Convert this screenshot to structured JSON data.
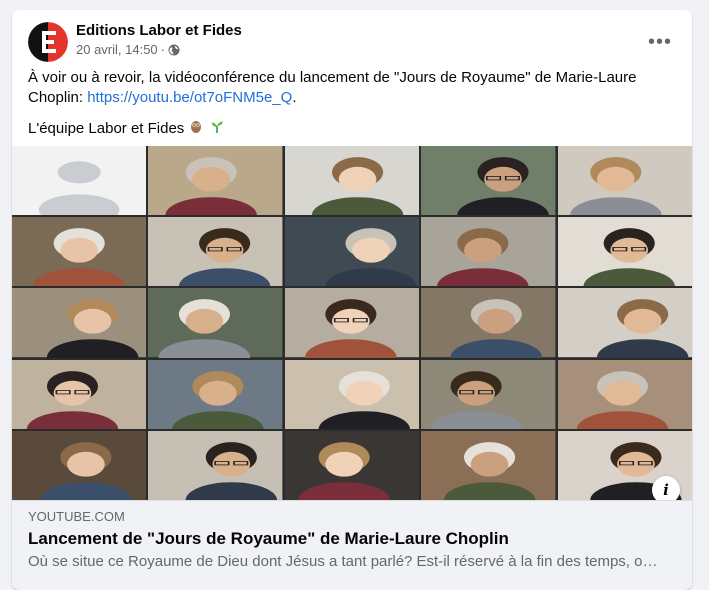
{
  "post": {
    "page_name": "Editions Labor et Fides",
    "timestamp": "20 avril, 14:50",
    "separator": "·",
    "privacy_icon": "globe-icon",
    "more_icon": "more-options-icon",
    "more_label": "•••",
    "text": {
      "line1_prefix": "À voir ou à revoir, la vidéoconférence du lancement de \"Jours de Royaume\" de Marie-Laure Choplin: ",
      "link": "https://youtu.be/ot7oFNM5e_Q",
      "line1_suffix": ".",
      "line2": "L'équipe Labor et Fides",
      "emojis": [
        "owl-emoji",
        "seedling-emoji"
      ]
    }
  },
  "media": {
    "alt": "Vidéoconférence",
    "info_label": "i"
  },
  "link_card": {
    "domain": "YOUTUBE.COM",
    "title": "Lancement de \"Jours de Royaume\" de Marie-Laure Choplin",
    "description": "Où se situe ce Royaume de Dieu dont Jésus a tant parlé? Est-il réservé à la fin des temps, ou a..."
  },
  "colors": {
    "link": "#216fdb",
    "secondary_text": "#65676b",
    "card_bg": "#f0f2f5",
    "logo_red": "#e5342b"
  }
}
